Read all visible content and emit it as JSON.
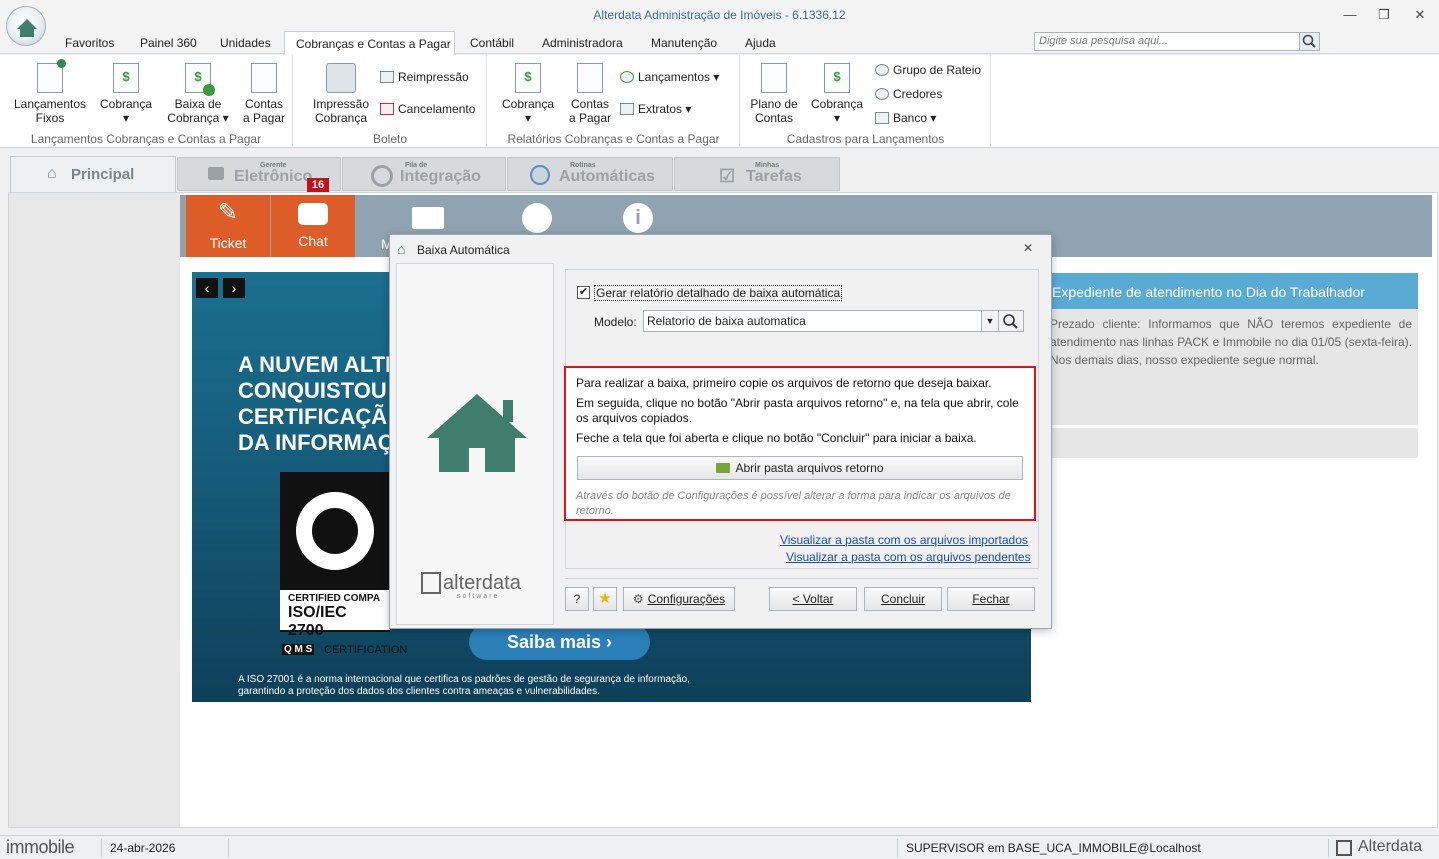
{
  "window": {
    "title": "Alterdata Administração de Imóveis - 6.1336.12",
    "minimize": "—",
    "restore": "❐",
    "close": "✕"
  },
  "menu": [
    "Favoritos",
    "Painel 360",
    "Unidades",
    "Cobranças e Contas a Pagar",
    "Contábil",
    "Administradora",
    "Manutenção",
    "Ajuda"
  ],
  "search": {
    "placeholder": "Digite sua pesquisa aqui..."
  },
  "ribbon": {
    "groups": [
      "Lançamentos Cobranças e Contas a Pagar",
      "Boleto",
      "Relatórios Cobranças e Contas a Pagar",
      "Cadastros para Lançamentos"
    ],
    "lanc_fixos": [
      "Lançamentos",
      "Fixos"
    ],
    "cobranca1": [
      "Cobrança",
      "▾"
    ],
    "baixa": [
      "Baixa de",
      "Cobrança ▾"
    ],
    "contas_pagar": [
      "Contas",
      "a Pagar"
    ],
    "impressao": [
      "Impressão",
      "Cobrança"
    ],
    "reimpressao": "Reimpressão",
    "cancelamento": "Cancelamento",
    "cobranca2": [
      "Cobrança",
      "▾"
    ],
    "contas_pagar2": [
      "Contas",
      "a Pagar"
    ],
    "lancamentos": "Lançamentos ▾",
    "extratos": "Extratos ▾",
    "plano": [
      "Plano de",
      "Contas"
    ],
    "cobranca3": [
      "Cobrança",
      "▾"
    ],
    "grupo_rateio": "Grupo de Rateio",
    "credores": "Credores",
    "banco": "Banco ▾"
  },
  "tabs": {
    "principal": "Principal",
    "eletronico_sub": "Gerente",
    "eletronico": "Eletrônico",
    "badge": "16",
    "integracao_sub": "Fila de",
    "integracao": "Integração",
    "automaticas_sub": "Rotinas",
    "automaticas": "Automáticas",
    "tarefas_sub": "Minhas",
    "tarefas": "Tarefas"
  },
  "topband": {
    "ticket": "Ticket",
    "chat": "Chat",
    "m": "M"
  },
  "banner": {
    "lines": [
      "A NUVEM ALTE",
      "CONQUISTOU A",
      "CERTIFICAÇÃ",
      "DA INFORMAÇ"
    ],
    "cert": "CERTIFIED COMPA",
    "iso": "ISO/IEC 2700",
    "qms": "Q M S",
    "certification": "CERTIFICATION",
    "cta": "Saiba mais  ›",
    "footnote1": "A ISO 27001 é a norma internacional que certifica os padrões de gestão de segurança de informação,",
    "footnote2": "garantindo a proteção dos dados dos clientes contra ameaças e vulnerabilidades."
  },
  "news": {
    "title": "Expediente de atendimento no Dia do Trabalhador",
    "body": "Prezado cliente: Informamos que NÃO teremos expediente de atendimento nas linhas PACK e Immobile no dia 01/05 (sexta-feira). Nos demais dias, nosso expediente segue normal."
  },
  "dialog": {
    "title": "Baixa Automática",
    "checkbox_label": "Gerar relatório detalhado de baixa automática",
    "modelo_label": "Modelo:",
    "modelo_value": "Relatorio de baixa automatica",
    "instr1": "Para realizar a baixa, primeiro copie os arquivos de retorno que deseja baixar.",
    "instr2": "Em seguida, clique no botão \"Abrir pasta arquivos retorno\" e, na tela que abrir, cole os arquivos copiados.",
    "instr3": "Feche a tela que foi aberta e clique no botão \"Concluir\" para iniciar a baixa.",
    "open_folder": "Abrir pasta arquivos retorno",
    "hint": "Através do botão de Configurações é possível alterar a forma para indicar os arquivos de retorno.",
    "link1": "Visualizar a pasta com os arquivos importados",
    "link2": "Visualizar a pasta com os arquivos pendentes",
    "help": "?",
    "config": "Configurações",
    "voltar": "< Voltar",
    "concluir": "Concluir",
    "fechar": "Fechar",
    "brand": "alterdata",
    "brand_sub": "software"
  },
  "status": {
    "product": "immobile",
    "date": "24-abr-2026",
    "user": "SUPERVISOR em BASE_UCA_IMMOBILE@Localhost",
    "brand": "Alterdata"
  },
  "colors": {
    "accent": "#3a6ea5",
    "orange": "#de5c27",
    "house": "#3f7d6c",
    "highlight": "#e0121b"
  }
}
